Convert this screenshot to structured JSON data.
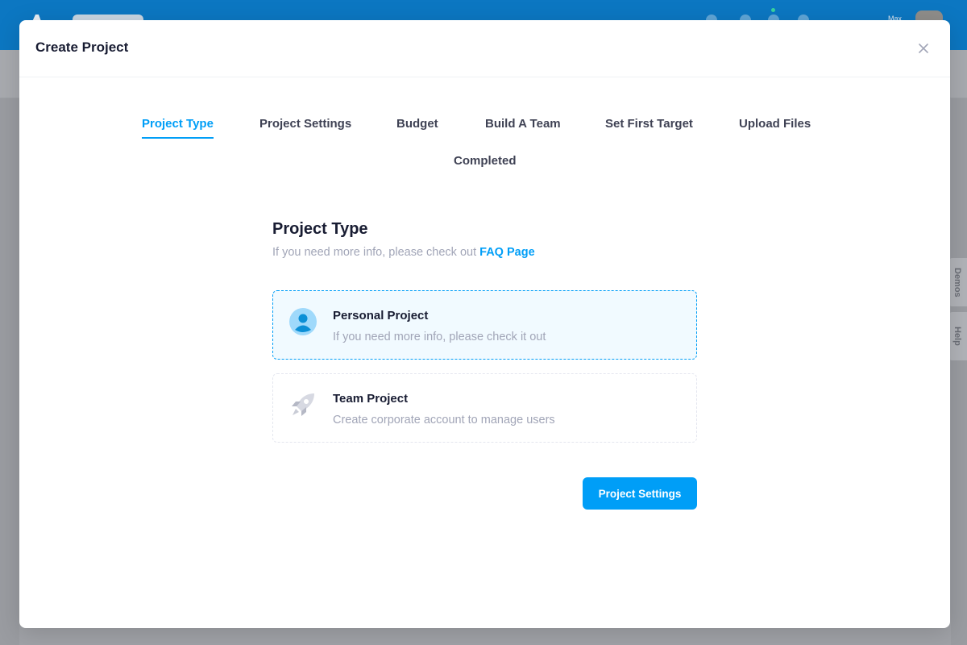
{
  "background": {
    "header_user_label": "Max",
    "side_tabs": [
      "Demos",
      "Help"
    ]
  },
  "modal": {
    "title": "Create Project",
    "close_icon": "close-icon"
  },
  "stepper": {
    "steps": [
      {
        "label": "Project Type",
        "active": true
      },
      {
        "label": "Project Settings",
        "active": false
      },
      {
        "label": "Budget",
        "active": false
      },
      {
        "label": "Build A Team",
        "active": false
      },
      {
        "label": "Set First Target",
        "active": false
      },
      {
        "label": "Upload Files",
        "active": false
      },
      {
        "label": "Completed",
        "active": false
      }
    ]
  },
  "project_type": {
    "heading": "Project Type",
    "subtext": "If you need more info, please check out",
    "faq_link": "FAQ Page",
    "options": [
      {
        "title": "Personal Project",
        "description": "If you need more info, please check it out",
        "icon": "user-icon",
        "selected": true
      },
      {
        "title": "Team Project",
        "description": "Create corporate account to manage users",
        "icon": "rocket-icon",
        "selected": false
      }
    ],
    "next_button": "Project Settings"
  },
  "colors": {
    "accent": "#009ef7",
    "header_bg": "#0c77c2",
    "title_text": "#181c32",
    "muted_text": "#a1a5b7"
  }
}
